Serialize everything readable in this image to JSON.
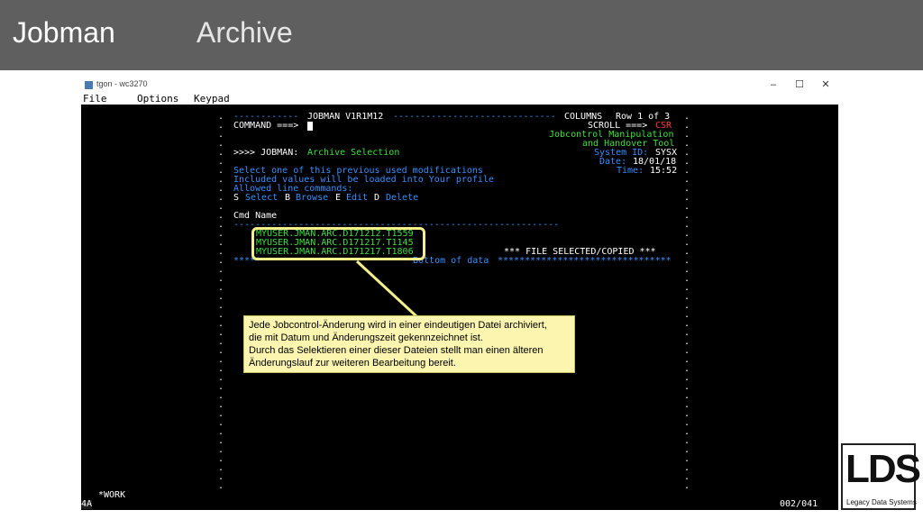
{
  "slide": {
    "title": "Jobman",
    "subtitle": "Archive"
  },
  "window": {
    "title": "tgon - wc3270",
    "buttons": [
      "–",
      "☐",
      "✕"
    ],
    "menu": [
      "File",
      "Options",
      "Keypad"
    ]
  },
  "terminal": {
    "header": {
      "dashes_left": "------------",
      "product": "JOBMAN V1R1M12",
      "dashes_right": "------------------------------",
      "columns_label": "COLUMNS",
      "row_info": "Row 1 of 3"
    },
    "command_label": "COMMAND ===>",
    "scroll": {
      "label": "SCROLL ===>",
      "value": "CSR"
    },
    "tool_name_1": "Jobcontrol Manipulation",
    "tool_name_2": "and Handover Tool",
    "system": {
      "label": "System ID:",
      "value": "SYSX"
    },
    "date": {
      "label": "Date:",
      "value": "18/01/18"
    },
    "time": {
      "label": "Time:",
      "value": "15:52"
    },
    "panel": {
      "prefix": ">>>> JOBMAN:",
      "title": "Archive Selection"
    },
    "instructions": [
      "Select one of this previous used modifications",
      "Included values will be loaded into Your profile",
      "Allowed line commands:"
    ],
    "commands": [
      {
        "key": "S",
        "label": "Select"
      },
      {
        "key": "B",
        "label": "Browse"
      },
      {
        "key": "E",
        "label": "Edit"
      },
      {
        "key": "D",
        "label": "Delete"
      }
    ],
    "columns": "Cmd Name",
    "rule": "------------------------------------------------------------",
    "files": [
      "MYUSER.JMAN.ARC.D171212.T1559",
      "MYUSER.JMAN.ARC.D171217.T1145",
      "MYUSER.JMAN.ARC.D171217.T1806"
    ],
    "status_message": "*** FILE SELECTED/COPIED ***",
    "bottom_left": "*****",
    "bottom_text": "Bottom of data",
    "bottom_right": "********************************",
    "oia": {
      "work": "*WORK",
      "mode": "4A",
      "position": "002/041"
    }
  },
  "callout": {
    "lines": [
      "Jede Jobcontrol-Änderung wird in einer eindeutigen Datei archiviert,",
      "die mit Datum und Änderungszeit gekennzeichnet ist.",
      "Durch das Selektieren einer dieser Dateien stellt man einen älteren",
      "Änderungslauf zur weiteren Bearbeitung bereit."
    ],
    "color": "#fbf5b0",
    "border_color": "#f3ef8a"
  },
  "logo": {
    "mark": "LDS",
    "caption": "Legacy Data Systems"
  },
  "colors": {
    "header_bg": "#5f5f5f",
    "terminal_bg": "#000000",
    "terminal_blue": "#3a8fff",
    "terminal_green": "#3ee03e",
    "terminal_red": "#ff3a3a",
    "terminal_white": "#ffffff",
    "terminal_cyan": "#37d0ff"
  }
}
